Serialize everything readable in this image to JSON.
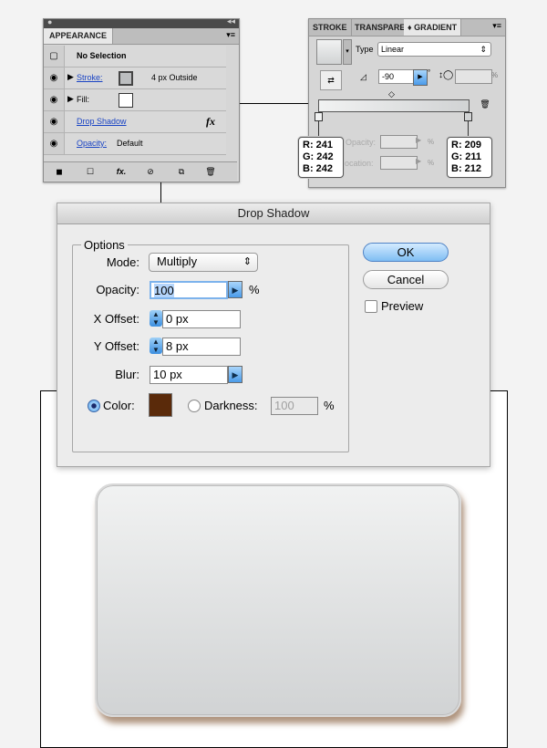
{
  "appearance": {
    "tab": "APPEARANCE",
    "selection": "No Selection",
    "stroke_label": "Stroke:",
    "stroke_value": "4 px  Outside",
    "fill_label": "Fill:",
    "effect_label": "Drop Shadow",
    "effect_icon": "fx",
    "opacity_label": "Opacity:",
    "opacity_value": "Default",
    "bottom_fx": "fx."
  },
  "gradient": {
    "tabs": [
      "STROKE",
      "TRANSPARE",
      "♦ GRADIENT"
    ],
    "type_label": "Type",
    "type_value": "Linear",
    "angle_value": "-90",
    "angle_unit": "°",
    "aspect_unit": "%",
    "opacity_label": "Opacity:",
    "opacity_unit": "%",
    "location_label": "Location:",
    "location_unit": "%",
    "left_stop": {
      "r": "R: 241",
      "g": "G: 242",
      "b": "B: 242"
    },
    "right_stop": {
      "r": "R: 209",
      "g": "G: 211",
      "b": "B: 212"
    }
  },
  "dialog": {
    "title": "Drop Shadow",
    "options_title": "Options",
    "mode_label": "Mode:",
    "mode_value": "Multiply",
    "opacity_label": "Opacity:",
    "opacity_value": "100",
    "opacity_unit": "%",
    "x_offset_label": "X Offset:",
    "x_offset_value": "0 px",
    "y_offset_label": "Y Offset:",
    "y_offset_value": "8 px",
    "blur_label": "Blur:",
    "blur_value": "10 px",
    "color_label": "Color:",
    "color_swatch": "#5a2a0a",
    "darkness_label": "Darkness:",
    "darkness_value": "100",
    "darkness_unit": "%",
    "ok_label": "OK",
    "cancel_label": "Cancel",
    "preview_label": "Preview"
  }
}
